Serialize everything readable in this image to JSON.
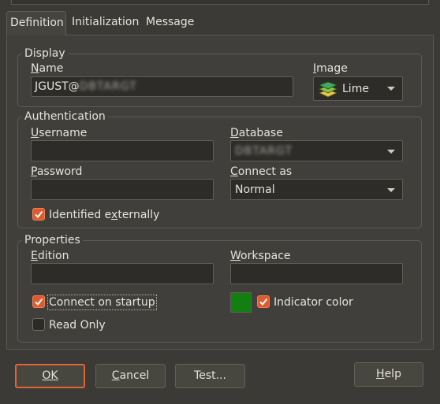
{
  "tabs": [
    {
      "label": "Definition"
    },
    {
      "label": "Initialization"
    },
    {
      "label": "Message"
    }
  ],
  "display": {
    "legend": "Display",
    "name_label": "Name",
    "name_value_prefix": "JGUST@",
    "name_value_obscured": "DBTARGT",
    "image_label": "Image",
    "image_value": "Lime",
    "image_icon": "layers-icon"
  },
  "authentication": {
    "legend": "Authentication",
    "username_label": "Username",
    "username_value": "",
    "database_label": "Database",
    "database_value_obscured": "DBTARGT",
    "password_label": "Password",
    "password_value": "",
    "connect_as_label": "Connect as",
    "connect_as_value": "Normal",
    "identified_externally_label": "Identified externally",
    "identified_externally_checked": true
  },
  "properties": {
    "legend": "Properties",
    "edition_label": "Edition",
    "edition_value": "",
    "workspace_label": "Workspace",
    "workspace_value": "",
    "connect_on_startup_label": "Connect on startup",
    "connect_on_startup_checked": true,
    "read_only_label": "Read Only",
    "read_only_checked": false,
    "indicator_color_label": "Indicator color",
    "indicator_color_checked": true,
    "indicator_color_hex": "#118011"
  },
  "buttons": {
    "ok": "OK",
    "cancel": "Cancel",
    "test": "Test...",
    "help": "Help"
  },
  "colors": {
    "accent": "#e05a2d",
    "background": "#3b3a36"
  }
}
